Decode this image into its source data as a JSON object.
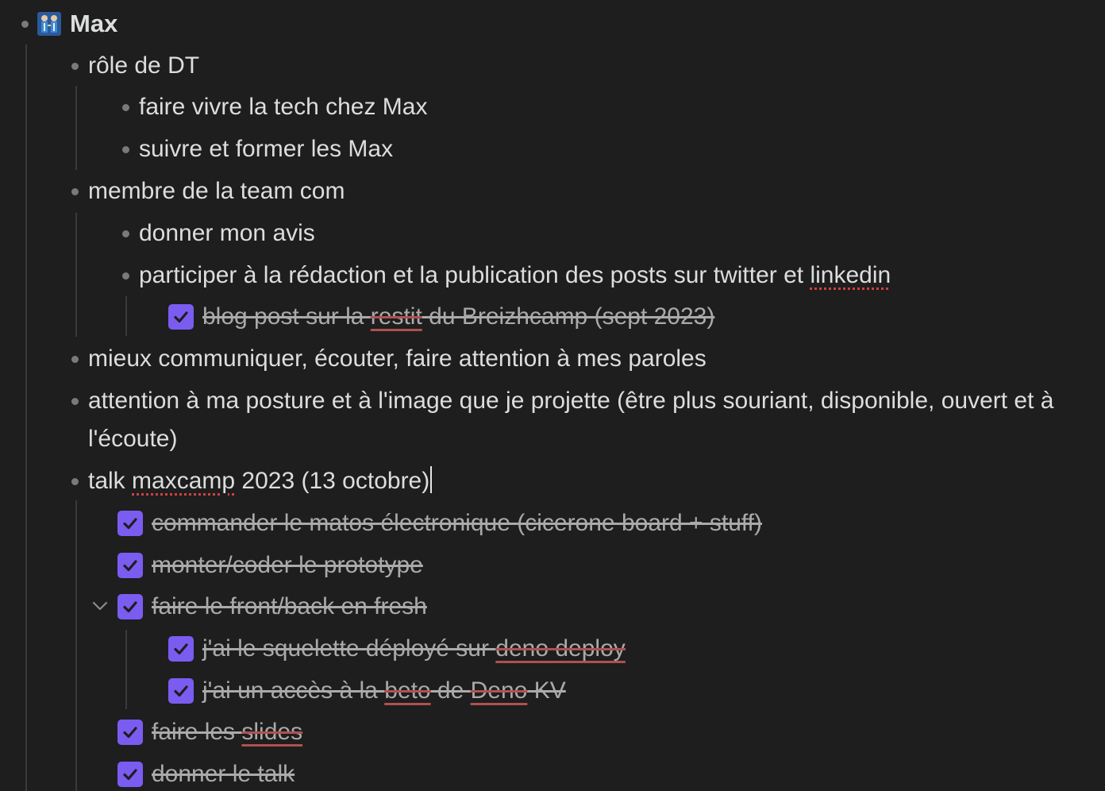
{
  "outline": {
    "root": {
      "label": "Max",
      "icon": "people-holding-hands-icon"
    },
    "role_dt": {
      "label": "rôle de DT"
    },
    "role_dt_1": {
      "label": "faire vivre la tech chez Max"
    },
    "role_dt_2": {
      "label": "suivre et former les Max"
    },
    "team_com": {
      "label": "membre de la team com"
    },
    "team_com_1": {
      "label": "donner mon avis"
    },
    "team_com_2": {
      "label_a": "participer à la rédaction et la publication des posts sur twitter et ",
      "label_b": "linkedin"
    },
    "team_com_2_task": {
      "label_a": " blog post sur la ",
      "label_b": "restit",
      "label_c": " du Breizhcamp (sept 2023)",
      "checked": true
    },
    "communicate": {
      "label": "mieux communiquer, écouter, faire attention à mes paroles"
    },
    "posture": {
      "label": "attention à ma posture et à l'image que je projette (être plus souriant, disponible, ouvert et à l'écoute)"
    },
    "talk": {
      "label_a": "talk ",
      "label_b": "maxcamp",
      "label_c": " 2023 (13 octobre)"
    },
    "talk_task_1": {
      "label": " commander le matos électronique (cicerone board + stuff)",
      "checked": true
    },
    "talk_task_2": {
      "label": " monter/coder le prototype",
      "checked": true
    },
    "talk_task_3": {
      "label": " faire le front/back en fresh",
      "checked": true,
      "expanded": true
    },
    "talk_task_3_1": {
      "label_a": " j'ai le squelette déployé sur ",
      "label_b": "deno deploy",
      "checked": true
    },
    "talk_task_3_2": {
      "label_a": " j'ai un accès à la ",
      "label_b": "beto",
      "label_c": " de ",
      "label_d": "Deno",
      "label_e": " KV",
      "checked": true
    },
    "talk_task_4": {
      "label_a": " faire les ",
      "label_b": "slides",
      "checked": true
    },
    "talk_task_5": {
      "label": " donner le talk",
      "checked": true
    }
  },
  "colors": {
    "background": "#1e1e1e",
    "text": "#dcddde",
    "checkbox": "#7b5cf0",
    "bullet": "#7a7a7a",
    "spellcheck": "#d04040"
  }
}
